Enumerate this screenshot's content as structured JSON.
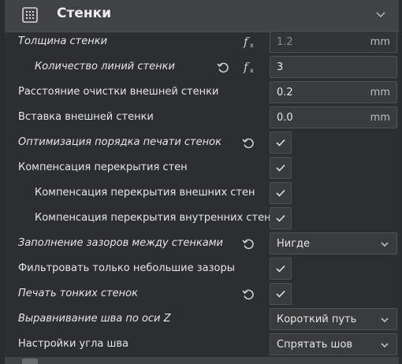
{
  "section": {
    "title": "Стенки",
    "icon": "walls-grid-icon",
    "collapse_icon": "chevron-down-icon"
  },
  "settings": {
    "wall_thickness": {
      "label": "Толщина стенки",
      "value": "1.2",
      "unit": "mm"
    },
    "wall_line_count": {
      "label": "Количество линий стенки",
      "value": "3"
    },
    "outer_wall_wipe": {
      "label": "Расстояние очистки внешней стенки",
      "value": "0.2",
      "unit": "mm"
    },
    "outer_wall_inset": {
      "label": "Вставка внешней стенки",
      "value": "0.0",
      "unit": "mm"
    },
    "optimize_wall_order": {
      "label": "Оптимизация порядка печати стенок"
    },
    "wall_overlap_comp": {
      "label": "Компенсация перекрытия стен"
    },
    "outer_overlap_comp": {
      "label": "Компенсация перекрытия внешних стен"
    },
    "inner_overlap_comp": {
      "label": "Компенсация перекрытия внутренних стен"
    },
    "fill_gaps": {
      "label": "Заполнение зазоров между стенками",
      "value": "Нигде"
    },
    "filter_small_gaps": {
      "label": "Фильтровать только небольшие зазоры"
    },
    "thin_walls": {
      "label": "Печать тонких стенок"
    },
    "z_seam_align": {
      "label": "Выравнивание шва по оси Z",
      "value": "Короткий путь"
    },
    "seam_corner": {
      "label": "Настройки угла шва",
      "value": "Спрятать шов"
    }
  },
  "colors": {
    "background": "#2d2e31",
    "header": "#414244",
    "field": "#3a3b3d",
    "border": "#505153",
    "text": "#e6e6e6"
  }
}
